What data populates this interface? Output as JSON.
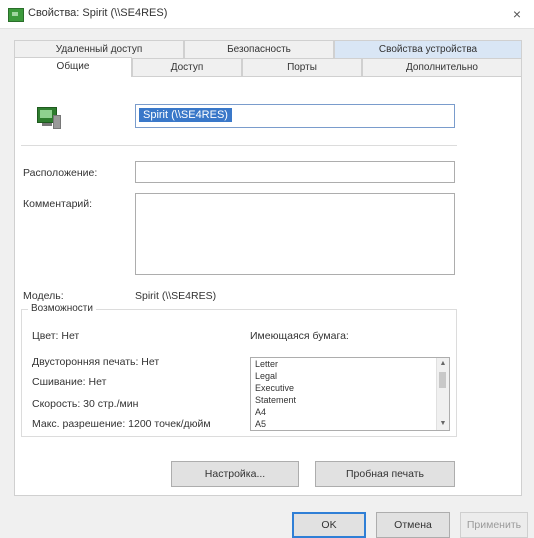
{
  "window": {
    "title": "Свойства: Spirit (\\\\SE4RES)",
    "close_icon": "×"
  },
  "tabs_row1": [
    {
      "label": "Удаленный доступ"
    },
    {
      "label": "Безопасность"
    },
    {
      "label": "Свойства устройства"
    }
  ],
  "tabs_row2": [
    {
      "label": "Общие"
    },
    {
      "label": "Доступ"
    },
    {
      "label": "Порты"
    },
    {
      "label": "Дополнительно"
    }
  ],
  "general": {
    "name_value": "Spirit (\\\\SE4RES)",
    "location_label": "Расположение:",
    "location_value": "",
    "comment_label": "Комментарий:",
    "comment_value": "",
    "model_label": "Модель:",
    "model_value": "Spirit (\\\\SE4RES)"
  },
  "features": {
    "legend": "Возможности",
    "color_label": "Цвет: Нет",
    "duplex_label": "Двусторонняя печать: Нет",
    "staple_label": "Сшивание: Нет",
    "speed_label": "Скорость: 30 стр./мин",
    "resolution_label": "Макс. разрешение: 1200 точек/дюйм",
    "paper_label": "Имеющаяся бумага:",
    "paper_items": [
      "Letter",
      "Legal",
      "Executive",
      "Statement",
      "A4",
      "A5"
    ]
  },
  "buttons": {
    "settings": "Настройка...",
    "test_page": "Пробная печать",
    "ok": "OK",
    "cancel": "Отмена",
    "apply": "Применить"
  }
}
